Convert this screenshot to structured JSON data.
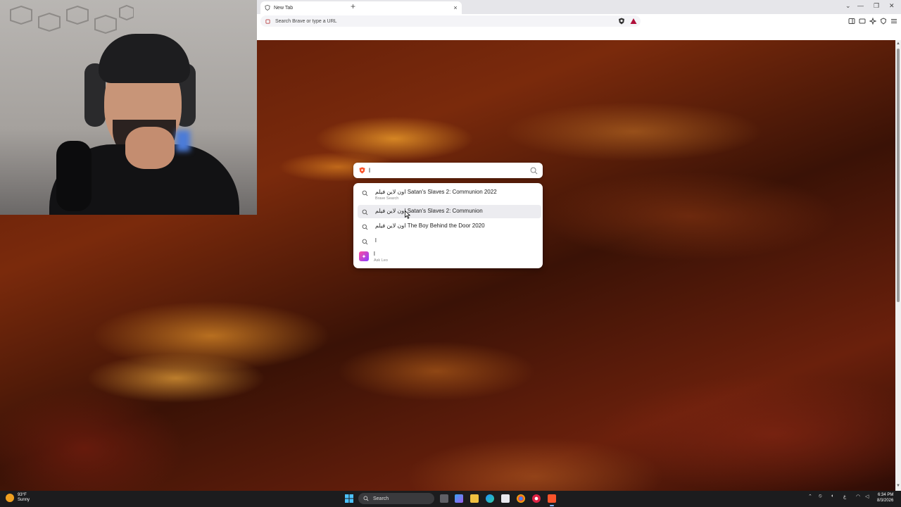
{
  "browser": {
    "tab_title": "New Tab",
    "tab_close": "×",
    "new_tab": "+",
    "omnibox_placeholder": "Search Brave or type a URL",
    "window_controls": [
      "⌄",
      "—",
      "❐",
      "✕"
    ]
  },
  "search_widget": {
    "query": "l",
    "suggestions": [
      {
        "text": "اون لاین فیلم Satan's Slaves 2: Communion 2022",
        "sub": "Brave Search",
        "icon": "search-icon"
      },
      {
        "text": "اون لاین فیلم Satan's Slaves 2: Communion",
        "sub": "",
        "icon": "search-icon",
        "highlighted": true
      },
      {
        "text": "اون لاین فیلم The Boy Behind the Door 2020",
        "sub": "",
        "icon": "search-icon"
      },
      {
        "text": "l",
        "sub": "",
        "icon": "search-icon"
      },
      {
        "text": "l",
        "sub": "Ask Leo",
        "icon": "leo-icon"
      }
    ]
  },
  "taskbar": {
    "weather_temp": "93°F",
    "weather_desc": "Sunny",
    "search_label": "Search",
    "time": "6:34 PM",
    "date": "8/3/2026"
  },
  "colors": {
    "brave_orange": "#fb542b",
    "leo_gradient_start": "#ff4fa0",
    "leo_gradient_end": "#8a3cff"
  }
}
